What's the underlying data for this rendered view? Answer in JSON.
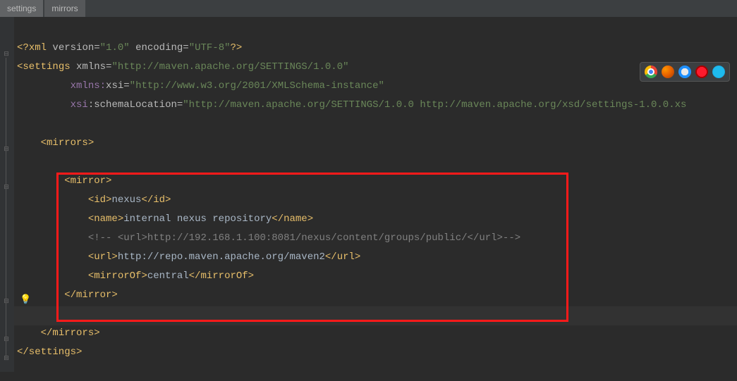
{
  "breadcrumb": {
    "item0": "settings",
    "item1": "mirrors"
  },
  "xml": {
    "decl_open": "<?",
    "decl_name": "xml",
    "version_attr": " version=",
    "version_val": "\"1.0\"",
    "encoding_attr": " encoding=",
    "encoding_val": "\"UTF-8\"",
    "decl_close": "?>",
    "settings_open_lt": "<",
    "settings_tag": "settings",
    "xmlns_attr": " xmlns=",
    "xmlns_val": "\"http://maven.apache.org/SETTINGS/1.0.0\"",
    "xmlns_xsi_pre": "xmlns:",
    "xmlns_xsi_name": "xsi",
    "xmlns_xsi_eq": "=",
    "xmlns_xsi_val": "\"http://www.w3.org/2001/XMLSchema-instance\"",
    "xsi_pre": "xsi",
    "xsi_colon": ":",
    "schemaLoc_attr": "schemaLocation=",
    "schemaLoc_val": "\"http://maven.apache.org/SETTINGS/1.0.0 http://maven.apache.org/xsd/settings-1.0.0.xs",
    "gt": ">",
    "mirrors_open": "<mirrors>",
    "mirror_open": "<mirror>",
    "id_open": "<id>",
    "id_text": "nexus",
    "id_close": "</id>",
    "name_open": "<name>",
    "name_text": "internal nexus repository",
    "name_close": "</name>",
    "comment": "<!-- <url>http://192.168.1.100:8081/nexus/content/groups/public/</url>-->",
    "url_open": "<url>",
    "url_text": "http://repo.maven.apache.org/maven2",
    "url_close": "</url>",
    "mirrorOf_open": "<mirrorOf>",
    "mirrorOf_text": "central",
    "mirrorOf_close": "</mirrorOf>",
    "mirror_close": "</mirror>",
    "mirrors_close": "</mirrors>",
    "settings_close": "</settings>"
  },
  "icons": {
    "chrome": "chrome-icon",
    "firefox": "firefox-icon",
    "safari": "safari-icon",
    "opera": "opera-icon",
    "ie": "ie-icon",
    "bulb": "💡"
  }
}
